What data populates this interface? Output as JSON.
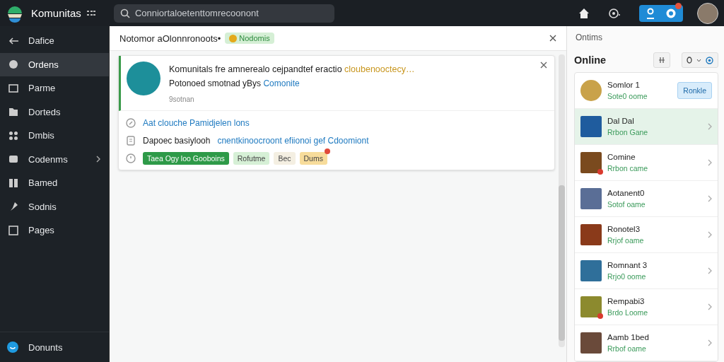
{
  "topbar": {
    "app_name": "Komunitas",
    "search": {
      "placeholder": "Conniortaloetenttomrecoonont"
    },
    "notification_badge": true
  },
  "sidebar": {
    "items": [
      {
        "label": "Dafice",
        "selected": false,
        "has_children": false
      },
      {
        "label": "Ordens",
        "selected": true,
        "has_children": false
      },
      {
        "label": "Parme",
        "selected": false,
        "has_children": false
      },
      {
        "label": "Dorteds",
        "selected": false,
        "has_children": false
      },
      {
        "label": "Dmbis",
        "selected": false,
        "has_children": false
      },
      {
        "label": "Codenms",
        "selected": false,
        "has_children": true
      },
      {
        "label": "Bamed",
        "selected": false,
        "has_children": false
      },
      {
        "label": "Sodnis",
        "selected": false,
        "has_children": false
      },
      {
        "label": "Pages",
        "selected": false,
        "has_children": false
      }
    ],
    "footer": {
      "label": "Donunts"
    }
  },
  "notifications": {
    "title": "Notomor aOlonnronoots•",
    "status_badge": "Nodomis",
    "card": {
      "title": "Komunitals  fre amnerealo cejpandtef eractio",
      "title_link": "cloubenooctecy…",
      "subtitle": "Potonoed smotnad yBys",
      "subtitle_link": "Comonite",
      "meta": "9sotnan",
      "lines": [
        {
          "kind": "link",
          "text": "Aat clouche Pamidjelen lons"
        },
        {
          "kind": "mixed",
          "text": "Dapoec basiylooh",
          "link": "cnentkinoocroont efiionoi gef Cdoomiont"
        },
        {
          "kind": "tags",
          "tags": [
            {
              "label": "Taea Ogy loo Gooboins",
              "color": "#2e9a48",
              "badge": false
            },
            {
              "label": "Rofutme",
              "color": "#d6f0d6",
              "badge": false
            },
            {
              "label": "Bec",
              "color": "#f4efe2",
              "badge": false
            },
            {
              "label": "Dums",
              "color": "#f7dc9b",
              "badge": true
            }
          ]
        }
      ]
    }
  },
  "online": {
    "caption": "Ontims",
    "title": "Online",
    "users": [
      {
        "name": "Somlor 1",
        "status": "Sote0 oome",
        "selected": false,
        "badge": false,
        "action": "Ronkle",
        "color": "#c9a24a"
      },
      {
        "name": "Dal Dal",
        "status": "Rrbon Gane",
        "selected": true,
        "badge": false,
        "color": "#1f5c9e"
      },
      {
        "name": "Comine",
        "status": "Rrbon came",
        "selected": false,
        "badge": true,
        "color": "#7a4a1e"
      },
      {
        "name": "Aotanent0",
        "status": "Sotof oame",
        "selected": false,
        "badge": false,
        "color": "#5a6e96"
      },
      {
        "name": "Ronotel3",
        "status": "Rrjof oame",
        "selected": false,
        "badge": false,
        "color": "#8a3a1a"
      },
      {
        "name": "Romnant 3",
        "status": "Rrjo0 oome",
        "selected": false,
        "badge": false,
        "color": "#2f6f9a"
      },
      {
        "name": "Rempabi3",
        "status": "Brdo Loome",
        "selected": false,
        "badge": true,
        "color": "#8c8a2e"
      },
      {
        "name": "Aamb 1bed",
        "status": "Rrbof oame",
        "selected": false,
        "badge": false,
        "color": "#6a4a3a"
      }
    ]
  }
}
